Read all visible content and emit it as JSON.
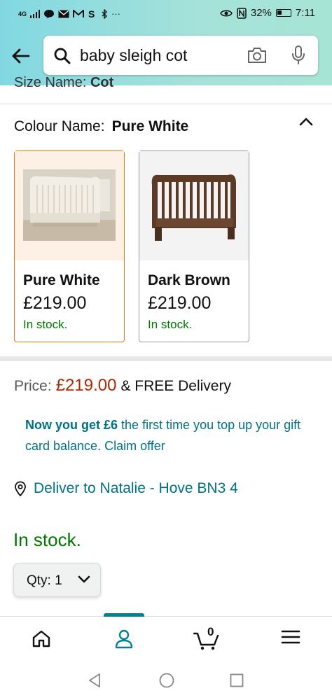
{
  "status_bar": {
    "network": "4G",
    "battery": "32%",
    "time": "7:11",
    "icons": [
      "signal-icon",
      "chat-icon",
      "mail-icon",
      "gmail-icon",
      "skype-icon",
      "bluetooth-icon",
      "more-icon",
      "eye-icon",
      "nfc-icon",
      "battery-icon"
    ]
  },
  "header": {
    "search_query": "baby sleigh cot",
    "icons": [
      "back-arrow-icon",
      "search-icon",
      "camera-icon",
      "microphone-icon"
    ]
  },
  "size_peek": {
    "label": "Size Name:",
    "value": "Cot"
  },
  "colour": {
    "label": "Colour Name:",
    "selected": "Pure White",
    "options": [
      {
        "name": "Pure White",
        "price": "£219.00",
        "stock": "In stock.",
        "selected": true
      },
      {
        "name": "Dark Brown",
        "price": "£219.00",
        "stock": "In stock.",
        "selected": false
      }
    ]
  },
  "price": {
    "label": "Price:",
    "value": "£219.00",
    "delivery": "& FREE Delivery"
  },
  "offer": {
    "bold": "Now you get £6",
    "rest": "the first time you top up your gift card balance. Claim offer"
  },
  "deliver_to": "Deliver to Natalie - Hove BN3 4",
  "availability": "In stock.",
  "quantity": {
    "label": "Qty:",
    "value": "1"
  },
  "bottom_nav": {
    "items": [
      "home",
      "account",
      "cart",
      "menu"
    ],
    "cart_count": "0",
    "active": "account"
  },
  "colors": {
    "teal": "#007185",
    "price_red": "#b12704",
    "stock_green": "#007600",
    "selected_orange": "#e47911"
  }
}
